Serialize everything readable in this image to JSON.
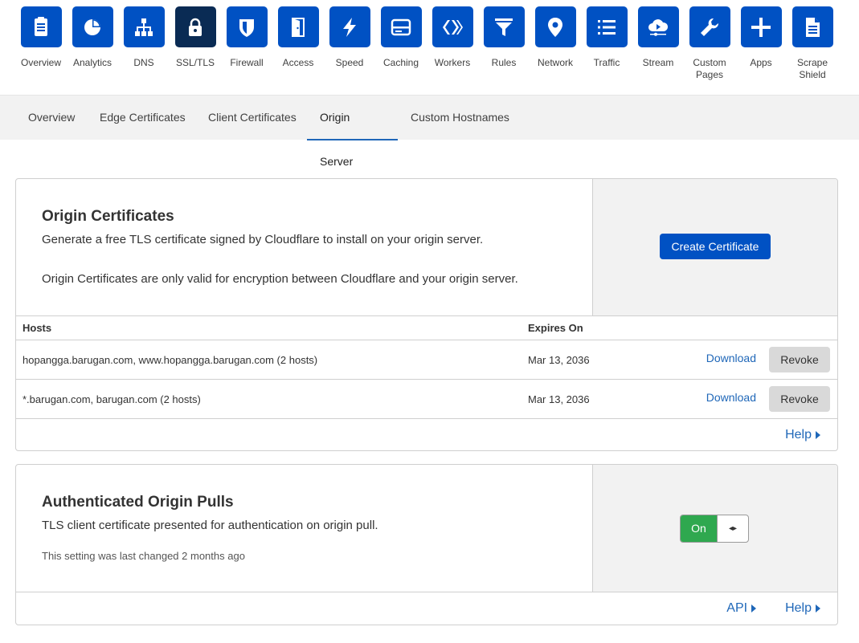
{
  "nav": {
    "items": [
      {
        "label": "Overview",
        "icon": "clipboard-icon"
      },
      {
        "label": "Analytics",
        "icon": "pie-chart-icon"
      },
      {
        "label": "DNS",
        "icon": "network-tree-icon"
      },
      {
        "label": "SSL/TLS",
        "icon": "lock-icon"
      },
      {
        "label": "Firewall",
        "icon": "shield-icon"
      },
      {
        "label": "Access",
        "icon": "door-icon"
      },
      {
        "label": "Speed",
        "icon": "lightning-icon"
      },
      {
        "label": "Caching",
        "icon": "server-drive-icon"
      },
      {
        "label": "Workers",
        "icon": "workers-icon"
      },
      {
        "label": "Rules",
        "icon": "filter-icon"
      },
      {
        "label": "Network",
        "icon": "map-pin-icon"
      },
      {
        "label": "Traffic",
        "icon": "list-icon"
      },
      {
        "label": "Stream",
        "icon": "cloud-play-icon"
      },
      {
        "label": "Custom Pages",
        "icon": "wrench-icon"
      },
      {
        "label": "Apps",
        "icon": "plus-icon"
      },
      {
        "label": "Scrape Shield",
        "icon": "document-icon"
      }
    ],
    "active_index": 3,
    "accent": "#0051c3",
    "active_color": "#0a2b54"
  },
  "subtabs": [
    {
      "label": "Overview"
    },
    {
      "label": "Edge Certificates"
    },
    {
      "label": "Client Certificates"
    },
    {
      "label": "Origin Server"
    },
    {
      "label": "Custom Hostnames"
    }
  ],
  "origin_certs": {
    "title": "Origin Certificates",
    "desc": "Generate a free TLS certificate signed by Cloudflare to install on your origin server.",
    "desc2": "Origin Certificates are only valid for encryption between Cloudflare and your origin server.",
    "create_button": "Create Certificate",
    "columns": {
      "hosts": "Hosts",
      "expires": "Expires On"
    },
    "rows": [
      {
        "hosts": "hopangga.barugan.com, www.hopangga.barugan.com (2 hosts)",
        "expires": "Mar 13, 2036",
        "download": "Download",
        "revoke": "Revoke"
      },
      {
        "hosts": "*.barugan.com, barugan.com (2 hosts)",
        "expires": "Mar 13, 2036",
        "download": "Download",
        "revoke": "Revoke"
      }
    ],
    "help": "Help"
  },
  "auth_pulls": {
    "title": "Authenticated Origin Pulls",
    "desc": "TLS client certificate presented for authentication on origin pull.",
    "note": "This setting was last changed 2 months ago",
    "toggle_label": "On",
    "toggle_handle": "◂▸",
    "toggle_color": "#2fa84f",
    "api": "API",
    "help": "Help"
  }
}
